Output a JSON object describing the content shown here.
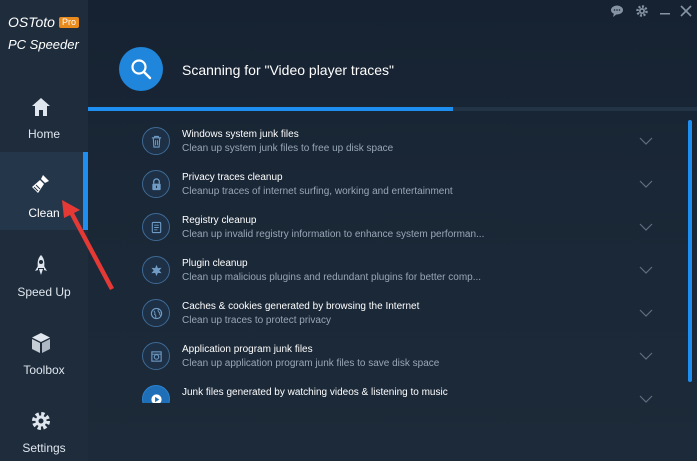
{
  "brand": {
    "name": "OSToto",
    "badge": "Pro",
    "product": "PC Speeder"
  },
  "sidebar": {
    "items": [
      {
        "label": "Home",
        "icon": "home-icon"
      },
      {
        "label": "Clean",
        "icon": "broom-icon",
        "active": true
      },
      {
        "label": "Speed Up",
        "icon": "rocket-icon"
      },
      {
        "label": "Toolbox",
        "icon": "box-icon"
      },
      {
        "label": "Settings",
        "icon": "gear-icon"
      }
    ]
  },
  "titlebar": {
    "icons": [
      "feedback-icon",
      "settings-icon",
      "minimize-icon",
      "close-icon"
    ]
  },
  "scan": {
    "title": "Scanning for \"Video player traces\"",
    "progress": 0.6
  },
  "items": [
    {
      "title": "Windows system junk files",
      "desc": "Clean up system junk files to free up disk space",
      "icon": "trash-icon"
    },
    {
      "title": "Privacy traces cleanup",
      "desc": "Cleanup traces of internet surfing, working and entertainment",
      "icon": "lock-icon"
    },
    {
      "title": "Registry cleanup",
      "desc": "Clean up invalid registry information to enhance system performan...",
      "icon": "registry-icon"
    },
    {
      "title": "Plugin cleanup",
      "desc": "Clean up malicious plugins and redundant plugins for better comp...",
      "icon": "puzzle-icon"
    },
    {
      "title": "Caches & cookies generated by browsing the Internet",
      "desc": "Clean up traces to protect privacy",
      "icon": "globe-icon"
    },
    {
      "title": "Application program junk files",
      "desc": "Clean up application program junk files to save disk space",
      "icon": "app-icon"
    },
    {
      "title": "Junk files generated by watching videos & listening to music",
      "desc": "",
      "icon": "play-icon"
    }
  ],
  "colors": {
    "accent": "#1f8ef1",
    "sidebar": "#1e2c3c",
    "badge": "#e98a1c",
    "arrow": "#e53935"
  }
}
